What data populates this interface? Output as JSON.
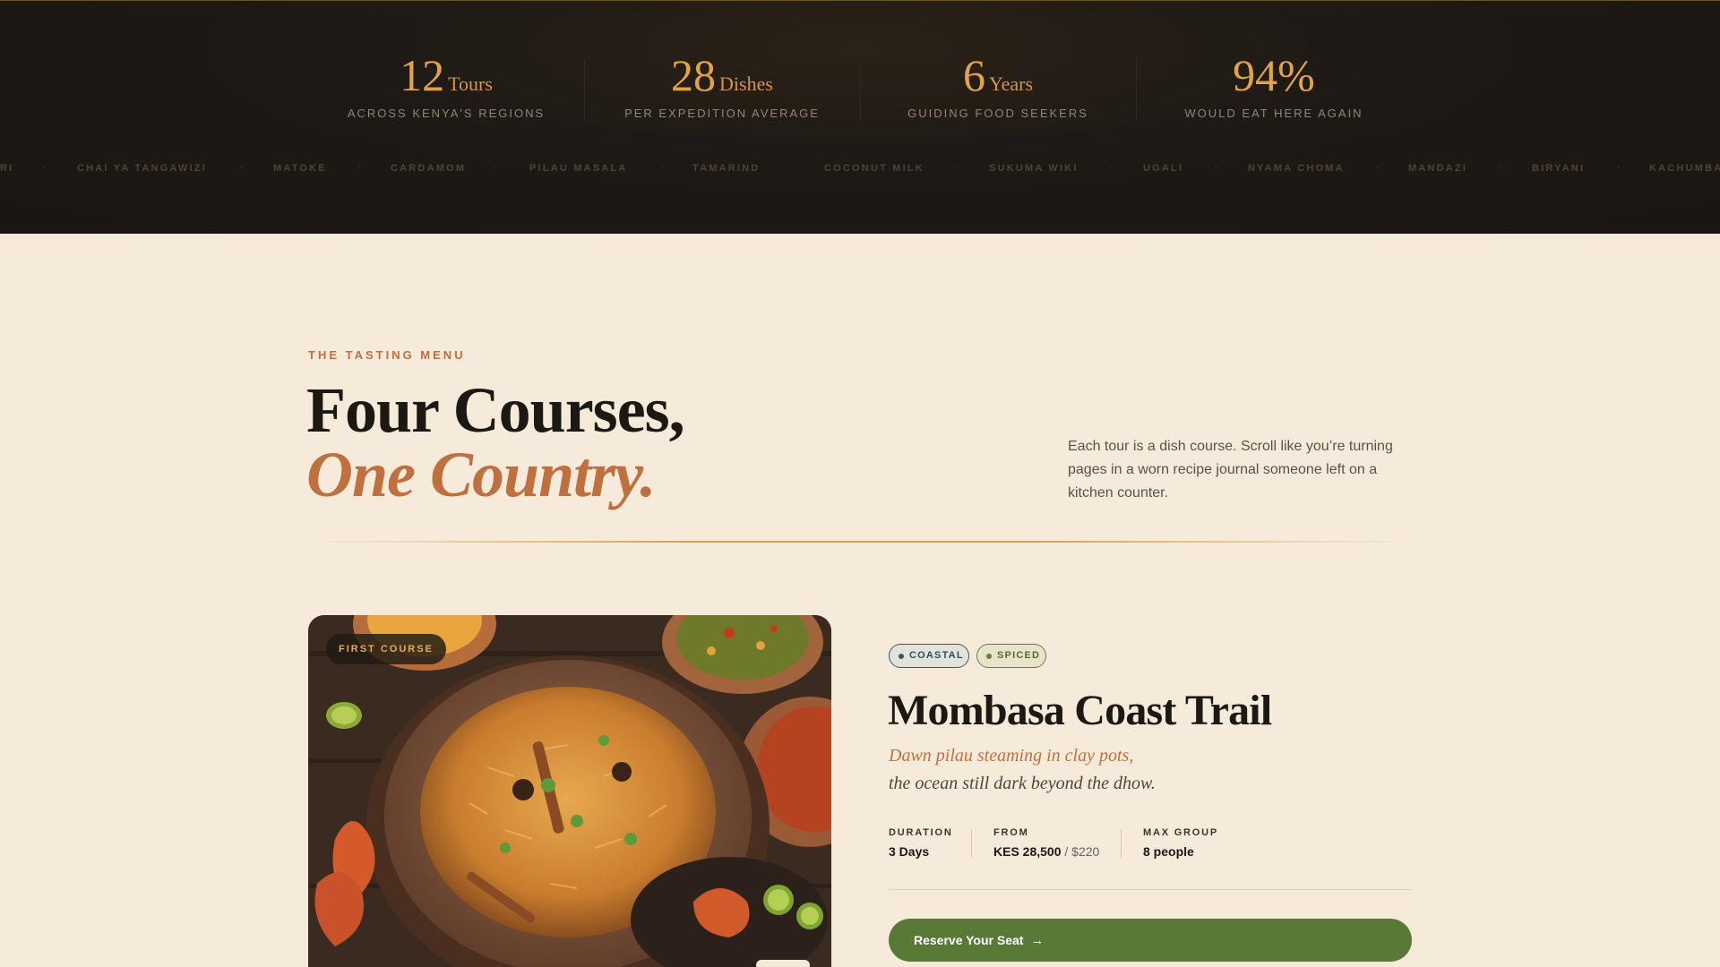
{
  "stats": [
    {
      "value": "12",
      "unit": "Tours",
      "caption": "ACROSS KENYA'S REGIONS"
    },
    {
      "value": "28",
      "unit": "Dishes",
      "caption": "PER EXPEDITION AVERAGE"
    },
    {
      "value": "6",
      "unit": "Years",
      "caption": "GUIDING FOOD SEEKERS"
    },
    {
      "value": "94%",
      "unit": "",
      "caption": "WOULD EAT HERE AGAIN"
    }
  ],
  "ticker": {
    "items": [
      "RI",
      "CHAI YA TANGAWIZI",
      "MATOKE",
      "CARDAMOM",
      "PILAU MASALA",
      "TAMARIND",
      "COCONUT MILK",
      "SUKUMA WIKI",
      "UGALI",
      "NYAMA CHOMA",
      "MANDAZI",
      "BIRYANI",
      "KACHUMBA"
    ],
    "separator": "·"
  },
  "intro": {
    "eyebrow": "THE TASTING MENU",
    "headline_line1": "Four Courses,",
    "headline_line2": "One Country.",
    "description": "Each tour is a dish course. Scroll like you’re turning pages in a worn recipe journal someone left on a kitchen counter."
  },
  "course": {
    "badge": "FIRST COURSE",
    "tags": [
      "COASTAL",
      "SPICED"
    ],
    "title": "Mombasa Coast Trail",
    "tagline_line1": "Dawn pilau steaming in clay pots,",
    "tagline_line2": "the ocean still dark beyond the dhow.",
    "meta": {
      "duration_label": "DURATION",
      "duration_value": "3 Days",
      "from_label": "FROM",
      "from_value": "KES 28,500",
      "from_usd": " / $220",
      "group_label": "MAX GROUP",
      "group_value": "8 people"
    },
    "cta_label": "Reserve Your Seat",
    "cta_icon": "arrow-right-icon"
  },
  "colors": {
    "gold": "#e0a34a",
    "terracotta": "#c0703f",
    "olive_button": "#587a36",
    "dark_band": "#1e1915",
    "cream": "#f6eadb"
  }
}
